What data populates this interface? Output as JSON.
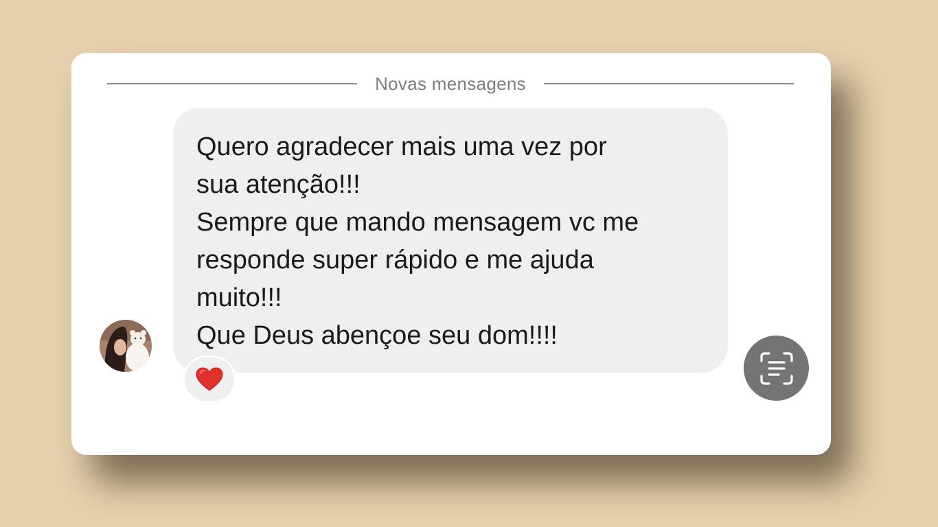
{
  "divider": {
    "label": "Novas mensagens"
  },
  "message": {
    "lines": [
      "Quero agradecer mais uma vez por",
      "sua atenção!!!",
      "Sempre que mando mensagem vc me",
      "responde super rápido e me ajuda",
      "muito!!!",
      "Que Deus abençoe seu dom!!!!"
    ]
  },
  "reaction": {
    "icon": "heart-icon",
    "color": "#e0302b"
  },
  "actions": {
    "scan_icon": "text-scan-icon"
  },
  "colors": {
    "background": "#e6d0ad",
    "bubble": "#efefef",
    "scan_button": "#747474"
  }
}
